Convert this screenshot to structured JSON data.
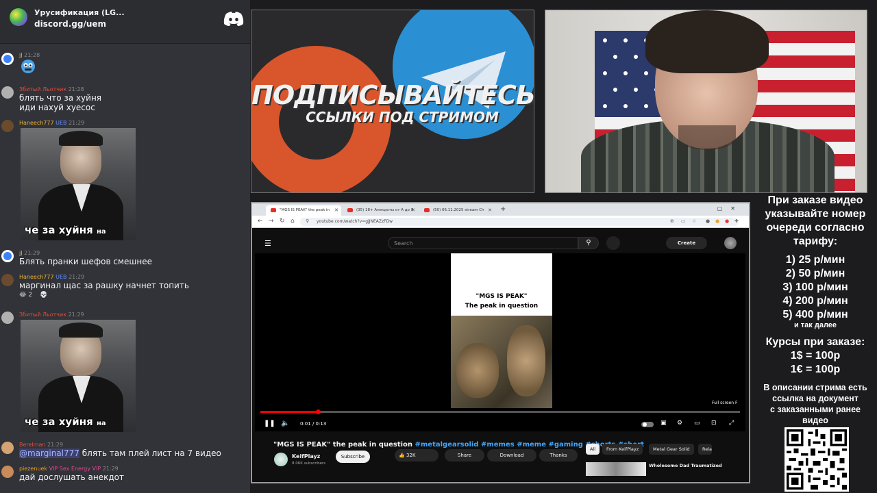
{
  "chat": {
    "server_name": "Урусификация (LG...",
    "server_link": "discord.gg/uem",
    "messages": [
      {
        "user": "jJ",
        "badges": "",
        "time": "21:28",
        "text": "",
        "color": "#f0b232",
        "avatar_color": "#3b82f6"
      },
      {
        "user": "Збитый Льотчик",
        "badges": "",
        "time": "21:28",
        "text": "блять что за хуйня\nиди нахуй хуесос",
        "color": "#e74c3c",
        "avatar_color": "#b0b0b0"
      },
      {
        "user": "Haneech777",
        "badges": "UEB",
        "time": "21:29",
        "text": "",
        "color": "#f0b232",
        "avatar_color": "#6b4a2e",
        "image_caption_big": "че за хуйня",
        "image_caption_small": "на стриме"
      },
      {
        "user": "jJ",
        "badges": "",
        "time": "21:29",
        "text": "Блять пранки шефов смешнее",
        "color": "#f0b232",
        "avatar_color": "#3b82f6"
      },
      {
        "user": "Haneech777",
        "badges": "UEB",
        "time": "21:29",
        "text": "маргинал щас за рашку начнет топить",
        "color": "#f0b232",
        "avatar_color": "#6b4a2e",
        "reactions": [
          "😂 2",
          "💀"
        ]
      },
      {
        "user": "Збитый Льотчик",
        "badges": "",
        "time": "21:29",
        "text": "",
        "color": "#e74c3c",
        "avatar_color": "#b0b0b0",
        "image_caption_big": "че за хуйня",
        "image_caption_small": "на стриме"
      },
      {
        "user": "Berelman",
        "badges": "",
        "time": "21:29",
        "text": "блять там плей лист на 7 видео",
        "mention": "@marginal777",
        "color": "#e74c3c",
        "avatar_color": "#d4a373"
      },
      {
        "user": "piezenuek",
        "badges": "VIP Sex Energy VIP",
        "time": "21:29",
        "text": "дай дослушать анекдот",
        "color": "#f39c12",
        "avatar_color": "#c98b5a"
      }
    ]
  },
  "banner": {
    "title": "ПОДПИСЫВАЙТЕСЬ",
    "subtitle": "ССЫЛКИ ПОД СТРИМОМ",
    "orange": "#d9552b",
    "blue": "#2b8fd3"
  },
  "browser": {
    "tabs": [
      {
        "label": "\"MGS IS PEAK\" the peak in",
        "active": true
      },
      {
        "label": "(35) 18+ Анекдоты от А до Я",
        "active": false
      },
      {
        "label": "(50) 06.11.2025 stream Ch",
        "active": false
      }
    ],
    "url": "youtube.com/watch?v=gjJNEAZzFDw"
  },
  "youtube": {
    "search_placeholder": "Search",
    "create_label": "Create",
    "video_text_1": "\"MGS IS PEAK\"",
    "video_text_2": "The peak in question",
    "fullscreen_tip": "Full screen  F",
    "time": "0:01 / 0:13",
    "progress": 0.12,
    "title_main": "\"MGS IS PEAK\" the peak in question ",
    "title_tags": "#metalgearsolid #memes #meme #gaming #shorts #short",
    "channel": "KeifPlayz",
    "subscribers": "8.06K subscribers",
    "subscribe": "Subscribe",
    "likes": "32K",
    "share": "Share",
    "download": "Download",
    "thanks": "Thanks",
    "chips": [
      "All",
      "From KeifPlayz",
      "Metal Gear Solid",
      "Rela"
    ],
    "rec_title": "Wholesome Dad Traumatized"
  },
  "info": {
    "line1": "При заказе видео",
    "line2": "указывайте номер",
    "line3": "очереди согласно",
    "line4": "тарифу:",
    "tiers": [
      "1) 25 р/мин",
      "2) 50 р/мин",
      "3) 100 р/мин",
      "4) 200 р/мин",
      "5) 400 р/мин"
    ],
    "etc": "и так далее",
    "rates_title": "Курсы при заказе:",
    "rate_usd": "1$ = 100р",
    "rate_eur": "1€ = 100р",
    "desc1": "В описании стрима есть",
    "desc2": "ссылка на документ",
    "desc3": "с заказанными ранее",
    "desc4": "видео"
  }
}
